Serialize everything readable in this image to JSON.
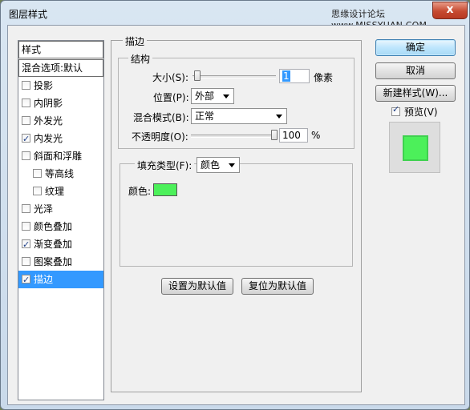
{
  "window": {
    "title": "图层样式",
    "watermark": "思缘设计论坛 www.MISSYUAN.COM",
    "close_glyph": "x"
  },
  "style_list": {
    "header": "样式",
    "blend_options": "混合选项:默认",
    "items": [
      {
        "label": "投影",
        "checked": false
      },
      {
        "label": "内阴影",
        "checked": false
      },
      {
        "label": "外发光",
        "checked": false
      },
      {
        "label": "内发光",
        "checked": true
      },
      {
        "label": "斜面和浮雕",
        "checked": false
      },
      {
        "label": "等高线",
        "checked": false
      },
      {
        "label": "纹理",
        "checked": false
      },
      {
        "label": "光泽",
        "checked": false
      },
      {
        "label": "颜色叠加",
        "checked": false
      },
      {
        "label": "渐变叠加",
        "checked": true
      },
      {
        "label": "图案叠加",
        "checked": false
      },
      {
        "label": "描边",
        "checked": true
      }
    ]
  },
  "stroke": {
    "section_title": "描边",
    "structure_title": "结构",
    "size_label": "大小(S):",
    "size_value": "1",
    "size_unit": "像素",
    "position_label": "位置(P):",
    "position_value": "外部",
    "blend_label": "混合模式(B):",
    "blend_value": "正常",
    "opacity_label": "不透明度(O):",
    "opacity_value": "100",
    "opacity_unit": "%",
    "fill_type_label": "填充类型(F):",
    "fill_type_value": "颜色",
    "color_label": "颜色:",
    "color": "#4cf05a",
    "set_default": "设置为默认值",
    "reset_default": "复位为默认值"
  },
  "buttons": {
    "ok": "确定",
    "cancel": "取消",
    "new_style": "新建样式(W)..."
  },
  "preview": {
    "label": "预览(V)",
    "checked": true,
    "color": "#4cf05a"
  }
}
